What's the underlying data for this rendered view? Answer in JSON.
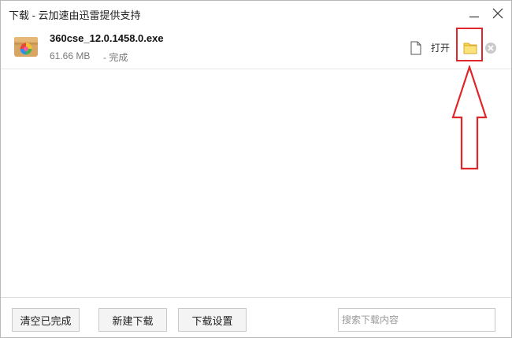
{
  "window": {
    "title": "下载 - 云加速由迅雷提供支持"
  },
  "download": {
    "file_name": "360cse_12.0.1458.0.exe",
    "file_size": "61.66 MB",
    "status": "- 完成",
    "open_label": "打开"
  },
  "footer": {
    "clear_completed": "清空已完成",
    "new_download": "新建下载",
    "download_settings": "下载设置",
    "search_placeholder": "搜索下载内容"
  },
  "colors": {
    "highlight_red": "#e0262a",
    "folder_yellow": "#f7d34a"
  },
  "icons": [
    "minimize-icon",
    "close-icon",
    "app-icon",
    "file-icon",
    "folder-icon",
    "cancel-icon",
    "up-arrow-annotation"
  ]
}
